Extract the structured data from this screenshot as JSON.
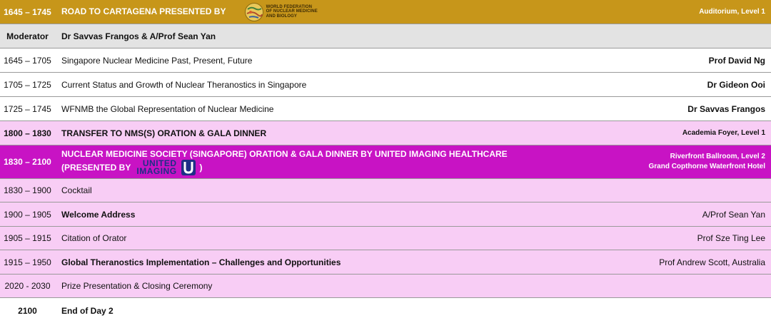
{
  "header": {
    "time": "1645 – 1745",
    "title": "ROAD TO CARTAGENA PRESENTED BY",
    "logo_text_1": "WORLD FEDERATION",
    "logo_text_2": "OF NUCLEAR MEDICINE",
    "logo_text_3": "AND BIOLOGY",
    "venue": "Auditorium, Level 1"
  },
  "moderator": {
    "label": "Moderator",
    "names": "Dr Savvas Frangos & A/Prof Sean Yan"
  },
  "session1": [
    {
      "time": "1645 – 1705",
      "title": "Singapore Nuclear Medicine Past, Present, Future",
      "speaker": "Prof David Ng"
    },
    {
      "time": "1705 – 1725",
      "title": "Current Status and Growth of Nuclear Theranostics in Singapore",
      "speaker": "Dr Gideon Ooi"
    },
    {
      "time": "1725 – 1745",
      "title": "WFNMB the Global Representation of Nuclear Medicine",
      "speaker": "Dr Savvas Frangos"
    }
  ],
  "transfer": {
    "time": "1800 – 1830",
    "title": "TRANSFER TO NMS(S) ORATION & GALA DINNER",
    "venue": "Academia Foyer, Level 1"
  },
  "gala": {
    "time": "1830 – 2100",
    "title_line1": "NUCLEAR MEDICINE SOCIETY (SINGAPORE) ORATION & GALA DINNER BY UNITED IMAGING HEALTHCARE",
    "title_line2_prefix": "(PRESENTED BY",
    "title_line2_suffix": ")",
    "logo_line1": "UNITED",
    "logo_line2": "IMAGING",
    "venue_line1": "Riverfront Ballroom, Level 2",
    "venue_line2": "Grand Copthorne Waterfront Hotel"
  },
  "session2": [
    {
      "time": "1830 – 1900",
      "title": "Cocktail",
      "speaker": "",
      "bold_title": false
    },
    {
      "time": "1900 – 1905",
      "title": "Welcome Address",
      "speaker": "A/Prof Sean Yan",
      "bold_title": true
    },
    {
      "time": "1905 – 1915",
      "title": "Citation of Orator",
      "speaker": "Prof Sze Ting Lee",
      "bold_title": false
    },
    {
      "time": "1915 – 1950",
      "title": "Global Theranostics Implementation – Challenges and Opportunities",
      "speaker": "Prof Andrew Scott, Australia",
      "bold_title": true
    },
    {
      "time": "2020 - 2030",
      "title": "Prize Presentation & Closing Ceremony",
      "speaker": "",
      "bold_title": false
    }
  ],
  "end": {
    "time": "2100",
    "title": "End of Day 2"
  },
  "colors": {
    "gold": "#c7961a",
    "magenta": "#c813c4",
    "pink": "#f8cdf5",
    "grey": "#e3e3e3"
  }
}
